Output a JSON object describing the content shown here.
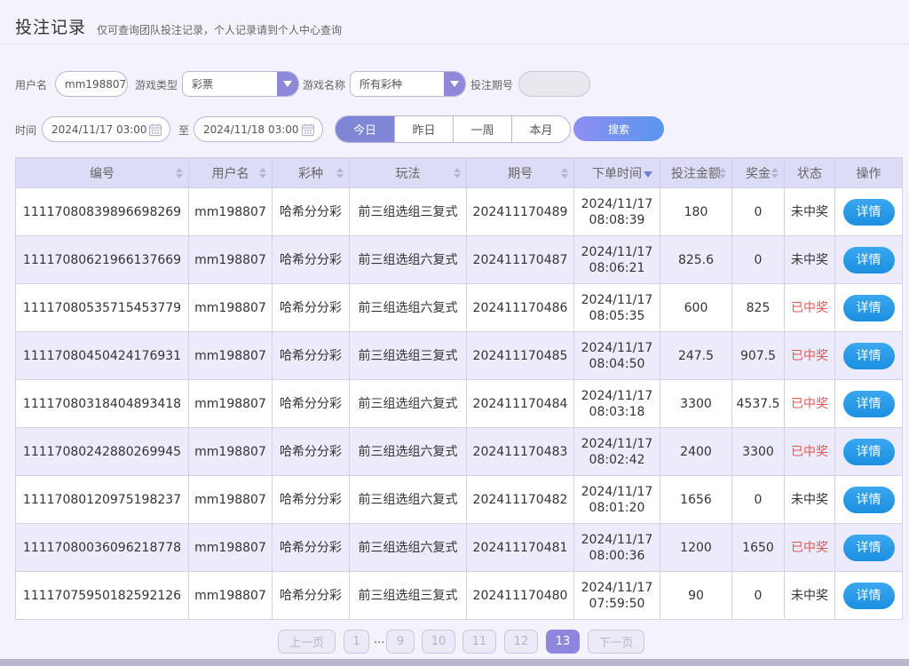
{
  "header": {
    "title": "投注记录",
    "subtitle": "仅可查询团队投注记录，个人记录请到个人中心查询"
  },
  "filters": {
    "username_label": "用户名",
    "username_value": "mm198807",
    "game_type_label": "游戏类型",
    "game_type_value": "彩票",
    "game_name_label": "游戏名称",
    "game_name_value": "所有彩种",
    "period_label": "投注期号",
    "period_value": "",
    "time_label": "时间",
    "start_time": "2024/11/17 03:00",
    "to_label": "至",
    "end_time": "2024/11/18 03:00",
    "quick_ranges": [
      "今日",
      "昨日",
      "一周",
      "本月"
    ],
    "active_range": "今日",
    "search_label": "搜索"
  },
  "table": {
    "headers": [
      "编号",
      "用户名",
      "彩种",
      "玩法",
      "期号",
      "下单时间",
      "投注金额",
      "奖金",
      "状态",
      "操作"
    ],
    "rows": [
      {
        "id": "11117080839896698269",
        "user": "mm198807",
        "lottery": "哈希分分彩",
        "play": "前三组选组三复式",
        "period": "202411170489",
        "date": "2024/11/17",
        "time": "08:08:39",
        "amount": "180",
        "prize": "0",
        "status": "未中奖",
        "win": false,
        "action": "详情"
      },
      {
        "id": "11117080621966137669",
        "user": "mm198807",
        "lottery": "哈希分分彩",
        "play": "前三组选组六复式",
        "period": "202411170487",
        "date": "2024/11/17",
        "time": "08:06:21",
        "amount": "825.6",
        "prize": "0",
        "status": "未中奖",
        "win": false,
        "action": "详情"
      },
      {
        "id": "11117080535715453779",
        "user": "mm198807",
        "lottery": "哈希分分彩",
        "play": "前三组选组六复式",
        "period": "202411170486",
        "date": "2024/11/17",
        "time": "08:05:35",
        "amount": "600",
        "prize": "825",
        "status": "已中奖",
        "win": true,
        "action": "详情"
      },
      {
        "id": "11117080450424176931",
        "user": "mm198807",
        "lottery": "哈希分分彩",
        "play": "前三组选组三复式",
        "period": "202411170485",
        "date": "2024/11/17",
        "time": "08:04:50",
        "amount": "247.5",
        "prize": "907.5",
        "status": "已中奖",
        "win": true,
        "action": "详情"
      },
      {
        "id": "11117080318404893418",
        "user": "mm198807",
        "lottery": "哈希分分彩",
        "play": "前三组选组六复式",
        "period": "202411170484",
        "date": "2024/11/17",
        "time": "08:03:18",
        "amount": "3300",
        "prize": "4537.5",
        "status": "已中奖",
        "win": true,
        "action": "详情"
      },
      {
        "id": "11117080242880269945",
        "user": "mm198807",
        "lottery": "哈希分分彩",
        "play": "前三组选组六复式",
        "period": "202411170483",
        "date": "2024/11/17",
        "time": "08:02:42",
        "amount": "2400",
        "prize": "3300",
        "status": "已中奖",
        "win": true,
        "action": "详情"
      },
      {
        "id": "11117080120975198237",
        "user": "mm198807",
        "lottery": "哈希分分彩",
        "play": "前三组选组六复式",
        "period": "202411170482",
        "date": "2024/11/17",
        "time": "08:01:20",
        "amount": "1656",
        "prize": "0",
        "status": "未中奖",
        "win": false,
        "action": "详情"
      },
      {
        "id": "11117080036096218778",
        "user": "mm198807",
        "lottery": "哈希分分彩",
        "play": "前三组选组六复式",
        "period": "202411170481",
        "date": "2024/11/17",
        "time": "08:00:36",
        "amount": "1200",
        "prize": "1650",
        "status": "已中奖",
        "win": true,
        "action": "详情"
      },
      {
        "id": "11117075950182592126",
        "user": "mm198807",
        "lottery": "哈希分分彩",
        "play": "前三组选组三复式",
        "period": "202411170480",
        "date": "2024/11/17",
        "time": "07:59:50",
        "amount": "90",
        "prize": "0",
        "status": "未中奖",
        "win": false,
        "action": "详情"
      }
    ]
  },
  "pagination": {
    "prev": "上一页",
    "first": "1",
    "ellipsis": "...",
    "pages": [
      "9",
      "10",
      "11",
      "12",
      "13"
    ],
    "current": "13",
    "next": "下一页"
  },
  "colors": {
    "accent": "#8d88dd",
    "win": "#e5554f",
    "detail_button": "#1c8fe0"
  }
}
